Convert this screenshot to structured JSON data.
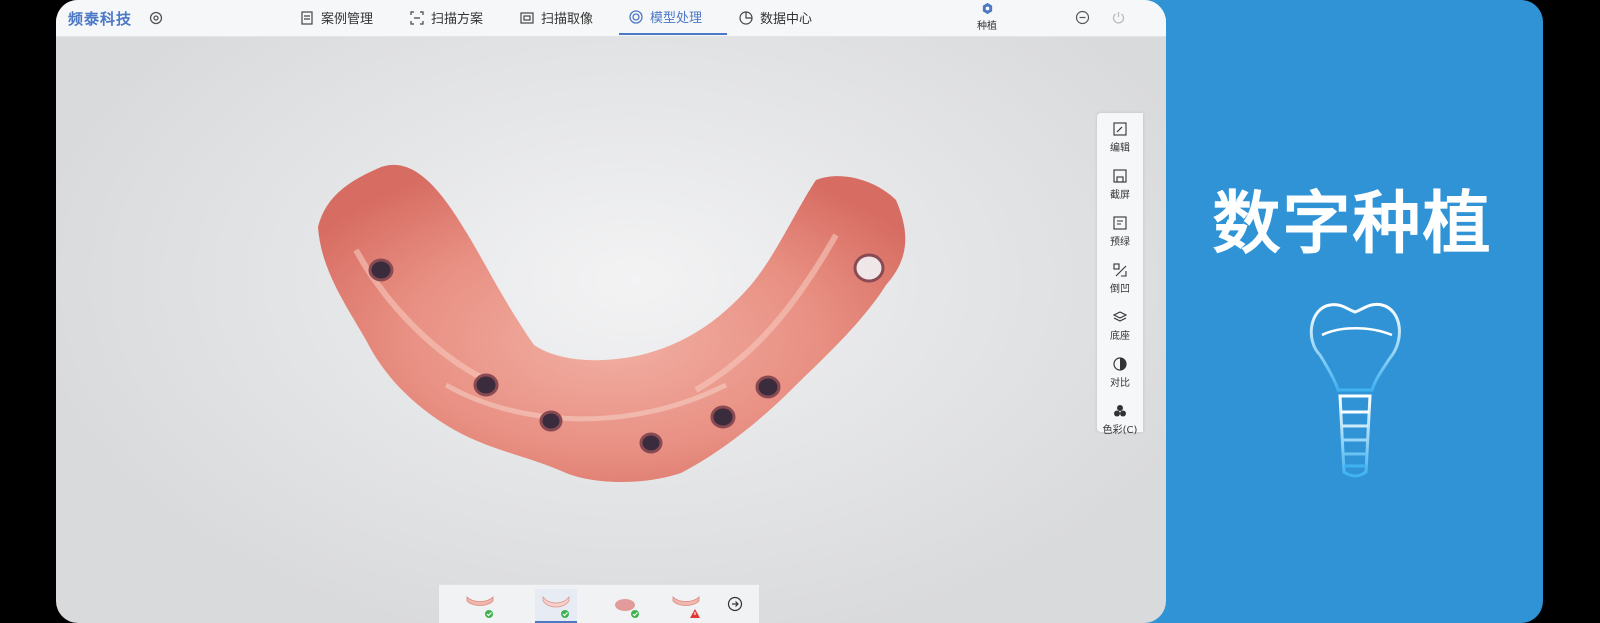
{
  "app": {
    "logo": "频泰科技",
    "nav": [
      {
        "label": "案例管理",
        "active": false
      },
      {
        "label": "扫描方案",
        "active": false
      },
      {
        "label": "扫描取像",
        "active": false
      },
      {
        "label": "模型处理",
        "active": true
      },
      {
        "label": "数据中心",
        "active": false
      }
    ],
    "implant_label": "种植",
    "accent": "#4c78c6"
  },
  "tools": [
    {
      "label": "编辑",
      "icon": "edit-icon"
    },
    {
      "label": "截屏",
      "icon": "save-icon"
    },
    {
      "label": "预绿",
      "icon": "preview-icon"
    },
    {
      "label": "倒凹",
      "icon": "undercut-icon"
    },
    {
      "label": "底座",
      "icon": "layers-icon"
    },
    {
      "label": "对比",
      "icon": "contrast-icon"
    },
    {
      "label": "色彩(C)",
      "icon": "color-icon"
    }
  ],
  "steps": [
    {
      "icon": "upper-jaw-icon",
      "status": "done"
    },
    {
      "icon": "lower-jaw-icon",
      "status": "done"
    },
    {
      "icon": "bite-icon",
      "status": "done"
    },
    {
      "icon": "jaw-scan-icon",
      "status": "warning"
    }
  ],
  "promo": {
    "title": "数字种植",
    "color": "#2f93d6"
  }
}
